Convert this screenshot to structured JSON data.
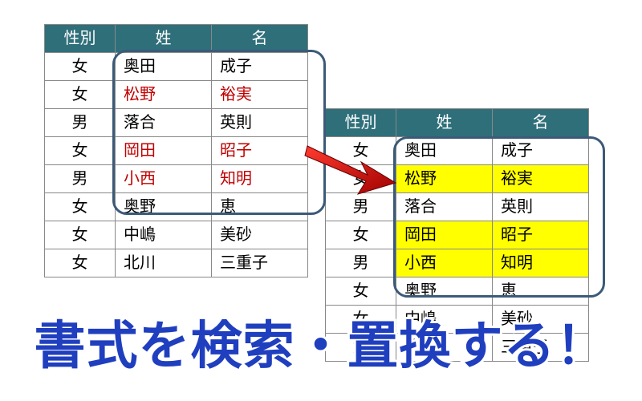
{
  "headers": {
    "gender": "性別",
    "last": "姓",
    "first": "名"
  },
  "left_rows": [
    {
      "gender": "女",
      "last": "奥田",
      "first": "成子",
      "red": false
    },
    {
      "gender": "女",
      "last": "松野",
      "first": "裕実",
      "red": true
    },
    {
      "gender": "男",
      "last": "落合",
      "first": "英則",
      "red": false
    },
    {
      "gender": "女",
      "last": "岡田",
      "first": "昭子",
      "red": true
    },
    {
      "gender": "男",
      "last": "小西",
      "first": "知明",
      "red": true
    },
    {
      "gender": "女",
      "last": "奥野",
      "first": "恵",
      "red": false
    },
    {
      "gender": "女",
      "last": "中嶋",
      "first": "美砂",
      "red": false
    },
    {
      "gender": "女",
      "last": "北川",
      "first": "三重子",
      "red": false
    }
  ],
  "right_rows": [
    {
      "gender": "女",
      "last": "奥田",
      "first": "成子",
      "yellow": false
    },
    {
      "gender": "女",
      "last": "松野",
      "first": "裕実",
      "yellow": true
    },
    {
      "gender": "男",
      "last": "落合",
      "first": "英則",
      "yellow": false
    },
    {
      "gender": "女",
      "last": "岡田",
      "first": "昭子",
      "yellow": true
    },
    {
      "gender": "男",
      "last": "小西",
      "first": "知明",
      "yellow": true
    },
    {
      "gender": "女",
      "last": "奥野",
      "first": "恵",
      "yellow": false
    },
    {
      "gender": "女",
      "last": "中嶋",
      "first": "美砂",
      "yellow": false
    },
    {
      "gender": "女",
      "last": "北川",
      "first": "三重子",
      "yellow": false
    }
  ],
  "headline": "書式を検索・置換する！",
  "colors": {
    "header_bg": "#2f6f7a",
    "red_text": "#c00000",
    "highlight": "#ffff00",
    "box_border": "#3c5a78",
    "headline": "#1f3fbf"
  }
}
